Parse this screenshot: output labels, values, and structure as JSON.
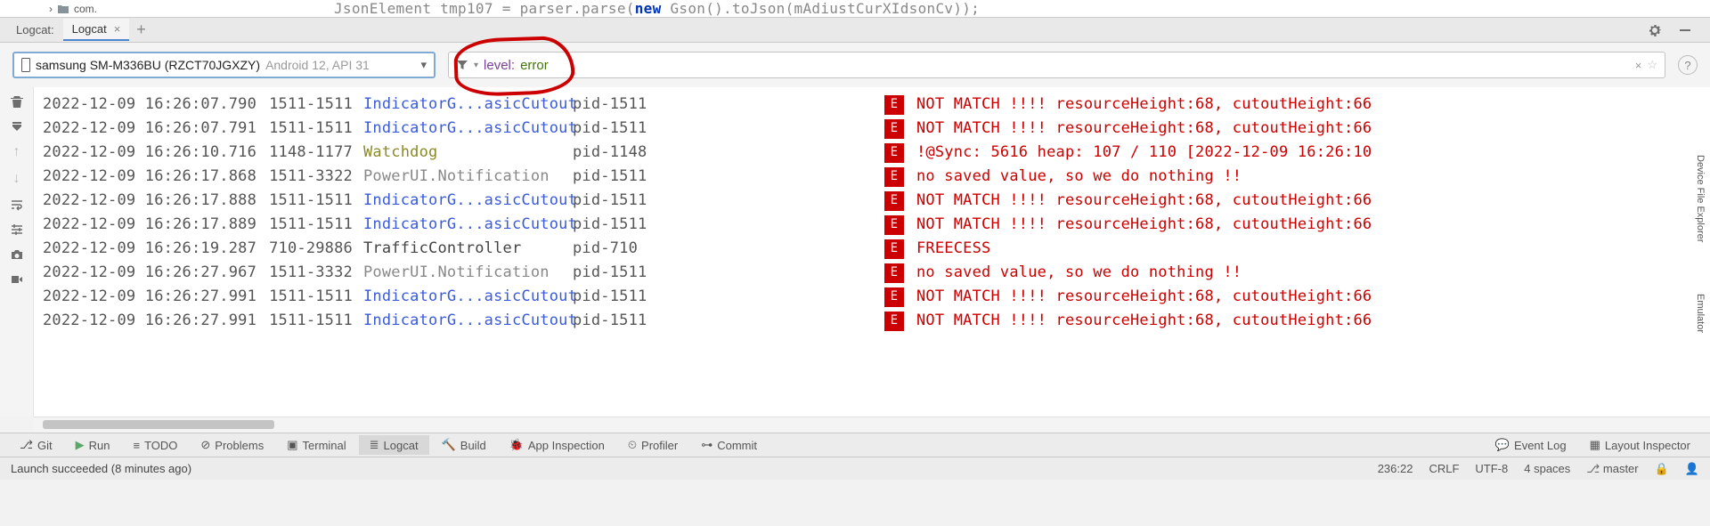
{
  "proj_tree": {
    "folder": "com."
  },
  "code": {
    "prefix": "JsonElement tmp107 = parser.parse(",
    "new": "new",
    "suffix": " Gson().toJson(mAdiustCurXIdsonCv));"
  },
  "tabs": {
    "fixed": "Logcat:",
    "active": "Logcat"
  },
  "device": {
    "name": "samsung SM-M336BU (RZCT70JGXZY)",
    "api": "Android 12, API 31"
  },
  "filter": {
    "key": "level:",
    "value": "error"
  },
  "rows": [
    {
      "ts": "2022-12-09 16:26:07.790",
      "pid": "1511-1511",
      "tag": "IndicatorG...asicCutout",
      "tagClass": "tag-blue",
      "proc": "pid-1511",
      "lvl": "E",
      "msg": "NOT MATCH !!!! resourceHeight:68, cutoutHeight:66"
    },
    {
      "ts": "2022-12-09 16:26:07.791",
      "pid": "1511-1511",
      "tag": "IndicatorG...asicCutout",
      "tagClass": "tag-blue",
      "proc": "pid-1511",
      "lvl": "E",
      "msg": "NOT MATCH !!!! resourceHeight:68, cutoutHeight:66"
    },
    {
      "ts": "2022-12-09 16:26:10.716",
      "pid": "1148-1177",
      "tag": "Watchdog",
      "tagClass": "tag-olive",
      "proc": "pid-1148",
      "lvl": "E",
      "msg": "!@Sync: 5616 heap: 107 / 110 [2022-12-09 16:26:10"
    },
    {
      "ts": "2022-12-09 16:26:17.868",
      "pid": "1511-3322",
      "tag": "PowerUI.Notification",
      "tagClass": "tag-gray",
      "proc": "pid-1511",
      "lvl": "E",
      "msg": "no saved value, so we do nothing !!"
    },
    {
      "ts": "2022-12-09 16:26:17.888",
      "pid": "1511-1511",
      "tag": "IndicatorG...asicCutout",
      "tagClass": "tag-blue",
      "proc": "pid-1511",
      "lvl": "E",
      "msg": "NOT MATCH !!!! resourceHeight:68, cutoutHeight:66"
    },
    {
      "ts": "2022-12-09 16:26:17.889",
      "pid": "1511-1511",
      "tag": "IndicatorG...asicCutout",
      "tagClass": "tag-blue",
      "proc": "pid-1511",
      "lvl": "E",
      "msg": "NOT MATCH !!!! resourceHeight:68, cutoutHeight:66"
    },
    {
      "ts": "2022-12-09 16:26:19.287",
      "pid": "710-29886",
      "tag": "TrafficController",
      "tagClass": "tag-dark",
      "proc": "pid-710",
      "lvl": "E",
      "msg": "FREECESS"
    },
    {
      "ts": "2022-12-09 16:26:27.967",
      "pid": "1511-3332",
      "tag": "PowerUI.Notification",
      "tagClass": "tag-gray",
      "proc": "pid-1511",
      "lvl": "E",
      "msg": "no saved value, so we do nothing !!"
    },
    {
      "ts": "2022-12-09 16:26:27.991",
      "pid": "1511-1511",
      "tag": "IndicatorG...asicCutout",
      "tagClass": "tag-blue",
      "proc": "pid-1511",
      "lvl": "E",
      "msg": "NOT MATCH !!!! resourceHeight:68, cutoutHeight:66"
    },
    {
      "ts": "2022-12-09 16:26:27.991",
      "pid": "1511-1511",
      "tag": "IndicatorG...asicCutout",
      "tagClass": "tag-blue",
      "proc": "pid-1511",
      "lvl": "E",
      "msg": "NOT MATCH !!!! resourceHeight:68, cutoutHeight:66"
    }
  ],
  "right_tabs": [
    "Device File Explorer",
    "Emulator"
  ],
  "bottom": {
    "items": [
      "Git",
      "Run",
      "TODO",
      "Problems",
      "Terminal",
      "Logcat",
      "Build",
      "App Inspection",
      "Profiler",
      "Commit"
    ],
    "right": [
      "Event Log",
      "Layout Inspector"
    ]
  },
  "status": {
    "left": "Launch succeeded (8 minutes ago)",
    "pos": "236:22",
    "crlf": "CRLF",
    "enc": "UTF-8",
    "indent": "4 spaces",
    "branch": "master"
  }
}
